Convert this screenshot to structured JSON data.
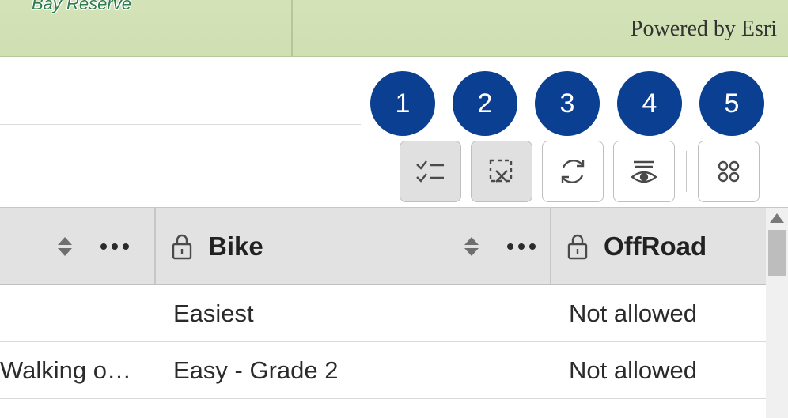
{
  "map": {
    "feature_label": "Bay Reserve",
    "attribution": "Powered by Esri"
  },
  "annotations": [
    "1",
    "2",
    "3",
    "4",
    "5"
  ],
  "toolbar": {
    "buttons": [
      {
        "name": "show-selection-button",
        "enabled": false,
        "icon": "checklist-icon"
      },
      {
        "name": "clear-selection-button",
        "enabled": false,
        "icon": "clear-selection-icon"
      },
      {
        "name": "refresh-button",
        "enabled": true,
        "icon": "refresh-icon"
      },
      {
        "name": "show-hide-columns-button",
        "enabled": true,
        "icon": "columns-visibility-icon"
      },
      {
        "name": "apps-button",
        "enabled": true,
        "icon": "grid-dots-icon"
      }
    ]
  },
  "table": {
    "columns": [
      {
        "label": "",
        "locked": false
      },
      {
        "label": "Bike",
        "locked": true
      },
      {
        "label": "OffRoad",
        "locked": true
      }
    ],
    "rows": [
      {
        "c0": "",
        "c1": "Easiest",
        "c2": "Not allowed"
      },
      {
        "c0": "Walking o…",
        "c1": "Easy - Grade 2",
        "c2": "Not allowed"
      }
    ]
  }
}
